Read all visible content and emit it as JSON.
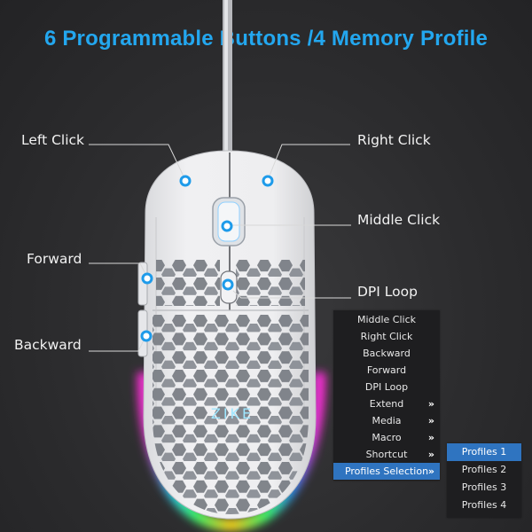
{
  "title": "6 Programmable Buttons /4 Memory Profile",
  "colors": {
    "title": "#23a7ef",
    "callout_dot": "#1e9bea",
    "menu_bg": "#1e1e20",
    "menu_selected": "#2f74c0"
  },
  "callouts": {
    "left_click": "Left Click",
    "right_click": "Right Click",
    "middle_click": "Middle Click",
    "forward": "Forward",
    "dpi_loop": "DPI Loop",
    "backward": "Backward"
  },
  "mouse_logo": "ZIKE",
  "menu": {
    "items": [
      {
        "label": "Middle Click",
        "submenu": false,
        "selected": false
      },
      {
        "label": "Right Click",
        "submenu": false,
        "selected": false
      },
      {
        "label": "Backward",
        "submenu": false,
        "selected": false
      },
      {
        "label": "Forward",
        "submenu": false,
        "selected": false
      },
      {
        "label": "DPI Loop",
        "submenu": false,
        "selected": false
      },
      {
        "label": "Extend",
        "submenu": true,
        "selected": false
      },
      {
        "label": "Media",
        "submenu": true,
        "selected": false
      },
      {
        "label": "Macro",
        "submenu": true,
        "selected": false
      },
      {
        "label": "Shortcut",
        "submenu": true,
        "selected": false
      },
      {
        "label": "Profiles Selection",
        "submenu": true,
        "selected": true
      }
    ],
    "submenu_arrow": "»"
  },
  "submenu": {
    "items": [
      {
        "label": "Profiles 1",
        "selected": true
      },
      {
        "label": "Profiles 2",
        "selected": false
      },
      {
        "label": "Profiles 3",
        "selected": false
      },
      {
        "label": "Profiles 4",
        "selected": false
      }
    ]
  }
}
